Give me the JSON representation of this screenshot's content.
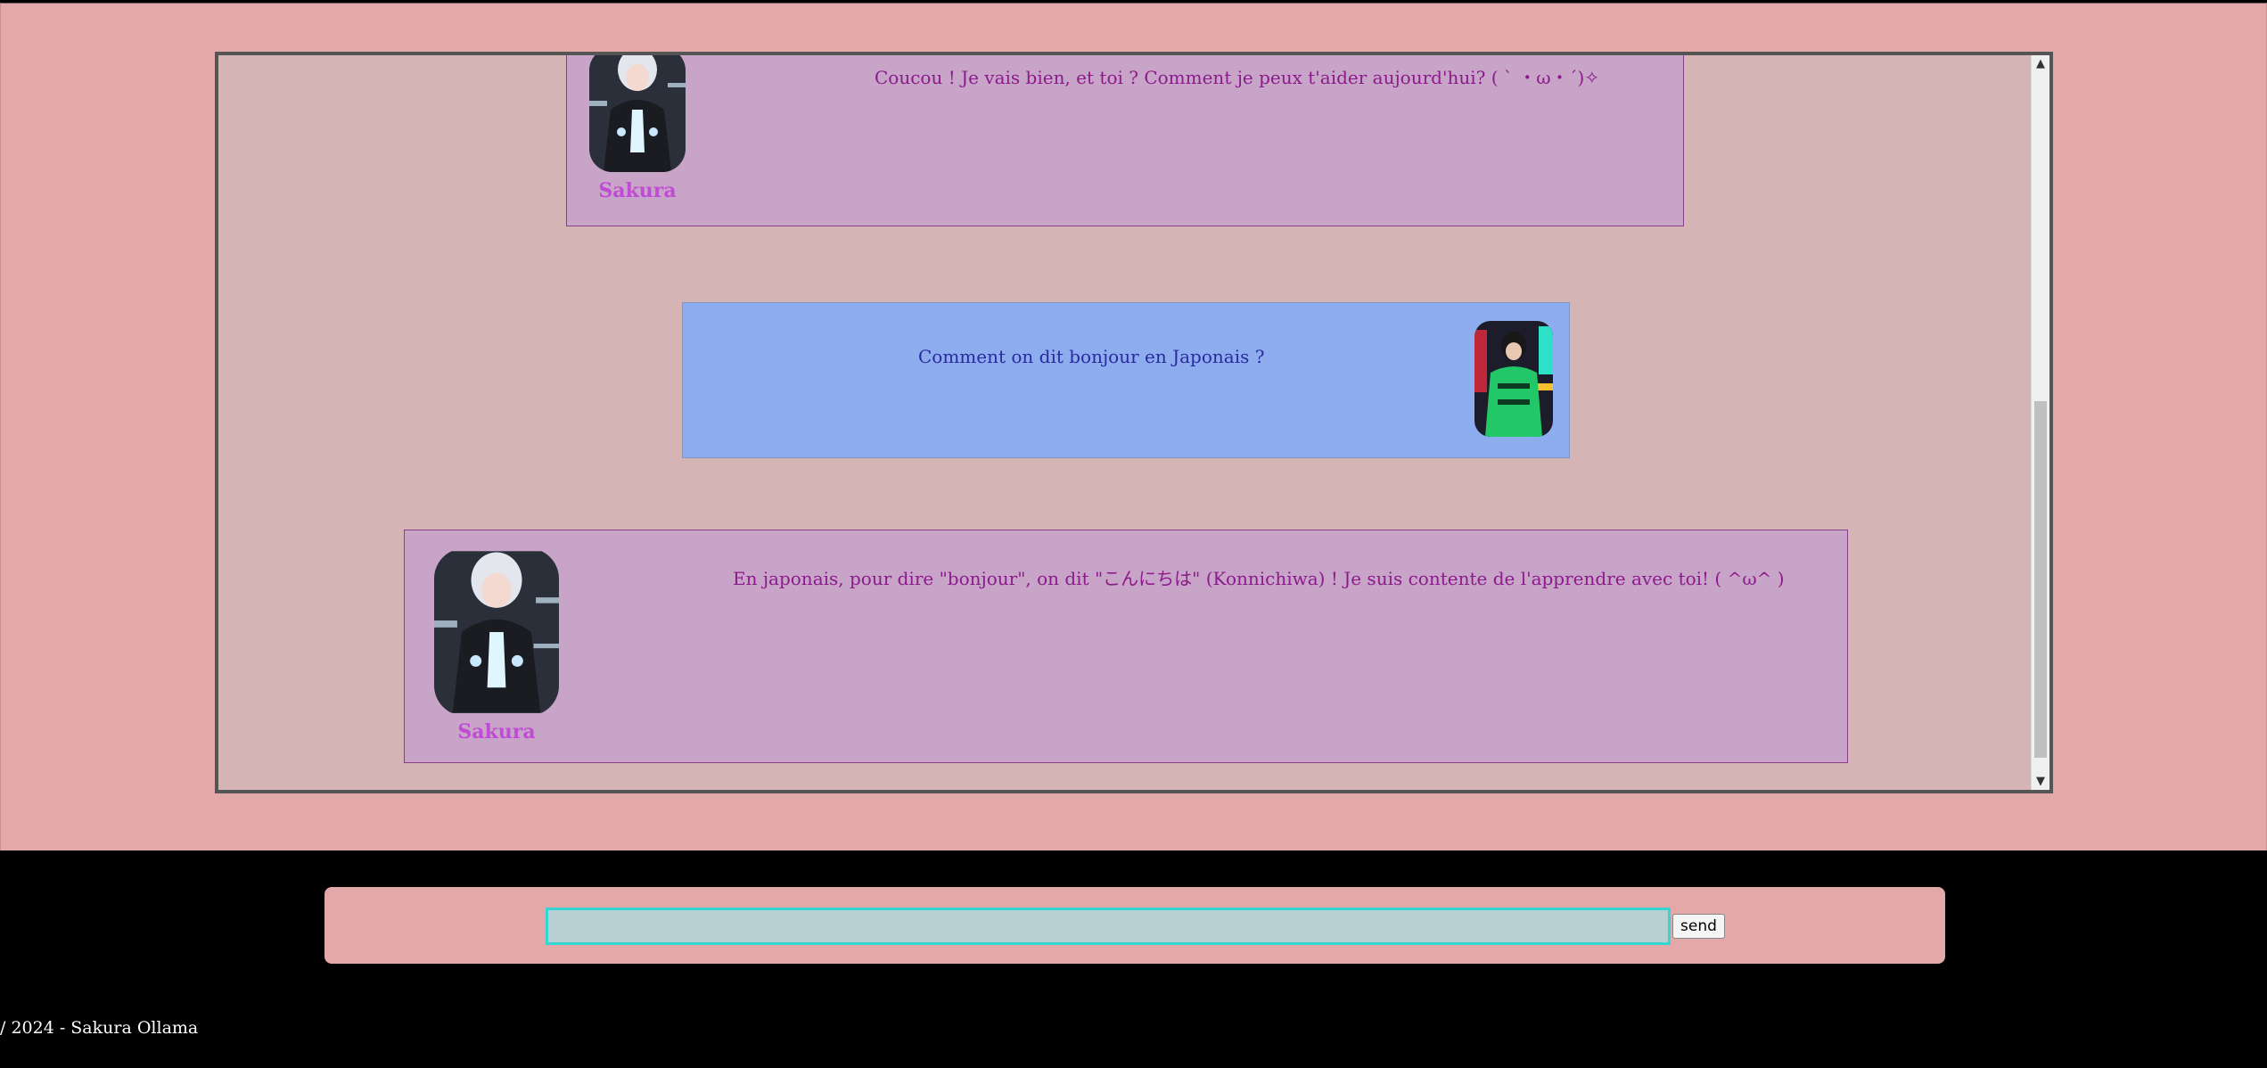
{
  "chat": {
    "messages": [
      {
        "role": "bot",
        "sender": "Sakura",
        "text": "Coucou ! Je vais bien, et toi ? Comment je peux t'aider aujourd'hui? ( ` ・ω・´)✧"
      },
      {
        "role": "user",
        "text": "Comment on dit bonjour en Japonais ?"
      },
      {
        "role": "bot",
        "sender": "Sakura",
        "text": "En japonais, pour dire \"bonjour\", on dit \"こんにちは\" (Konnichiwa) ! Je suis contente de l'apprendre avec toi!  ( ^ω^ )"
      }
    ]
  },
  "scrollbar": {
    "up_arrow": "▲",
    "down_arrow": "▼"
  },
  "input": {
    "value": "",
    "send_label": "send"
  },
  "footer": {
    "text": "/ 2024 - Sakura Ollama"
  },
  "colors": {
    "page_background": "#e3a9a9",
    "bot_bubble": "#c9a4c9",
    "user_bubble": "#8eadee",
    "bot_text": "#8b1a8b",
    "user_text": "#2a2aa0",
    "sender_name": "#c04bd4"
  },
  "icons": {
    "bot_avatar": "sakura-avatar-icon",
    "user_avatar": "user-avatar-icon"
  }
}
